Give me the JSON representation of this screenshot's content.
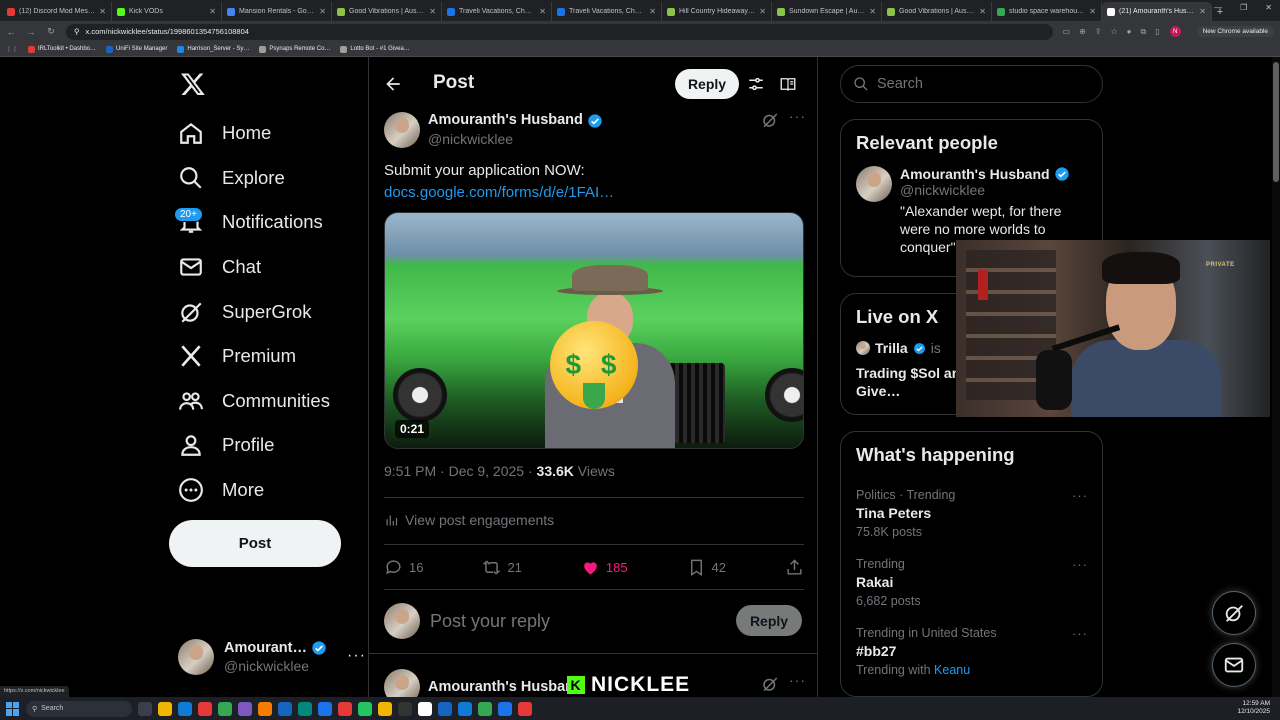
{
  "browser": {
    "tabs": [
      {
        "title": "(12) Discord Mod Messag…",
        "color": "#e53935"
      },
      {
        "title": "Kick VODs",
        "color": "#53fc18"
      },
      {
        "title": "Mansion Rentals - Google…",
        "color": "#4285f4"
      },
      {
        "title": "Good Vibrations | Austin…",
        "color": "#8bc34a"
      },
      {
        "title": "Traveli Vacations, Cheap Fl…",
        "color": "#1a73e8"
      },
      {
        "title": "Traveli Vacations, Cheap Fl…",
        "color": "#1a73e8"
      },
      {
        "title": "Hill Country Hideaway | A…",
        "color": "#8bc34a"
      },
      {
        "title": "Sundown Escape | Austin…",
        "color": "#8bc34a"
      },
      {
        "title": "Good Vibrations | Austin…",
        "color": "#8bc34a"
      },
      {
        "title": "studio space warehouse st…",
        "color": "#34a853"
      },
      {
        "title": "(21) Amouranth's Husban…",
        "color": "#ffffff",
        "active": true
      }
    ],
    "new_tab": "+",
    "url": "x.com/nickwicklee/status/1998601354756108804",
    "update_label": "New Chrome available",
    "profile_initial": "N",
    "bookmarks": [
      {
        "label": "IRLToolkit • Dashbo…",
        "color": "#e53935"
      },
      {
        "label": "UniFi Site Manager",
        "color": "#1565c0"
      },
      {
        "label": "Harrison_Server - Sy…",
        "color": "#1e88e5"
      },
      {
        "label": "Psynaps Remote Co…",
        "color": "#9e9e9e"
      },
      {
        "label": "Lotto Bot - #1 Givea…",
        "color": "#9e9e9e"
      }
    ],
    "status_url": "https://x.com/nickwicklee"
  },
  "nav": {
    "items": [
      {
        "label": "Home",
        "icon": "home-icon"
      },
      {
        "label": "Explore",
        "icon": "search-icon"
      },
      {
        "label": "Notifications",
        "icon": "bell-icon",
        "badge": "20+"
      },
      {
        "label": "Chat",
        "icon": "mail-icon"
      },
      {
        "label": "SuperGrok",
        "icon": "grok-icon"
      },
      {
        "label": "Premium",
        "icon": "x-icon"
      },
      {
        "label": "Communities",
        "icon": "people-icon"
      },
      {
        "label": "Profile",
        "icon": "person-icon"
      },
      {
        "label": "More",
        "icon": "more-circle-icon"
      }
    ],
    "post_button": "Post",
    "account": {
      "display_name": "Amourant…",
      "handle": "@nickwicklee",
      "more": "···"
    }
  },
  "post_view": {
    "title": "Post",
    "reply_label": "Reply",
    "author": {
      "display_name": "Amouranth's Husband",
      "handle": "@nickwicklee"
    },
    "text": "Submit your application NOW:",
    "link": "docs.google.com/forms/d/e/1FAI…",
    "media": {
      "duration": "0:21"
    },
    "meta": {
      "time": "9:51 PM · Dec 9, 2025 · ",
      "views_count": "33.6K",
      "views_label": " Views"
    },
    "engagements_label": "View post engagements",
    "actions": {
      "replies": "16",
      "reposts": "21",
      "likes": "185",
      "bookmarks": "42"
    },
    "reply_placeholder": "Post your reply",
    "reply_button": "Reply",
    "next_author": "Amouranth's Husband"
  },
  "sidebar": {
    "search_placeholder": "Search",
    "relevant_people": {
      "title": "Relevant people",
      "display_name": "Amouranth's Husband",
      "handle": "@nickwicklee",
      "bio": "\"Alexander wept, for there were no more worlds to conquer\""
    },
    "live": {
      "title": "Live on X",
      "host": "Trilla",
      "host_suffix": "is",
      "text": "Trading $Sol an… Gambling + Give…"
    },
    "happening": {
      "title": "What's happening",
      "trends": [
        {
          "context": "Politics · Trending",
          "name": "Tina Peters",
          "count": "75.8K posts"
        },
        {
          "context": "Trending",
          "name": "Rakai",
          "count": "6,682 posts"
        },
        {
          "context": "Trending in United States",
          "name": "#bb27",
          "with_label": "Trending with ",
          "with_link": "Keanu"
        }
      ]
    }
  },
  "overlay": {
    "watermark": "NICKLEE",
    "kick_letter": "K",
    "webcam_sign": "PRIVATE"
  },
  "taskbar": {
    "search_placeholder": "Search",
    "time": "12:59 AM",
    "date": "12/10/2025"
  },
  "colors": {
    "accent": "#1d9bf0",
    "like": "#f91880",
    "background": "#000000",
    "kick": "#53fc18"
  }
}
